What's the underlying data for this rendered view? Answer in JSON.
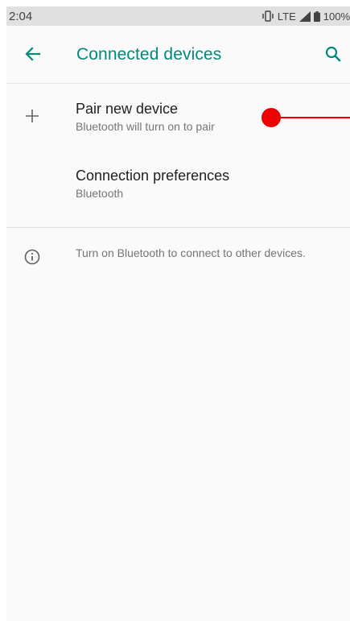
{
  "status_bar": {
    "time": "2:04",
    "network": "LTE",
    "battery": "100%",
    "icons": [
      "vibrate-icon",
      "signal-icon",
      "battery-icon"
    ]
  },
  "app_bar": {
    "title": "Connected devices",
    "back_icon": "arrow-left-icon",
    "search_icon": "search-icon",
    "accent_color": "#00897b"
  },
  "items": [
    {
      "title": "Pair new device",
      "summary": "Bluetooth will turn on to pair",
      "icon": "plus-icon"
    },
    {
      "title": "Connection preferences",
      "summary": "Bluetooth",
      "icon": ""
    }
  ],
  "footer": {
    "text": "Turn on Bluetooth to connect to other devices.",
    "icon": "info-icon"
  },
  "annotation": {
    "color": "#ee0000"
  }
}
